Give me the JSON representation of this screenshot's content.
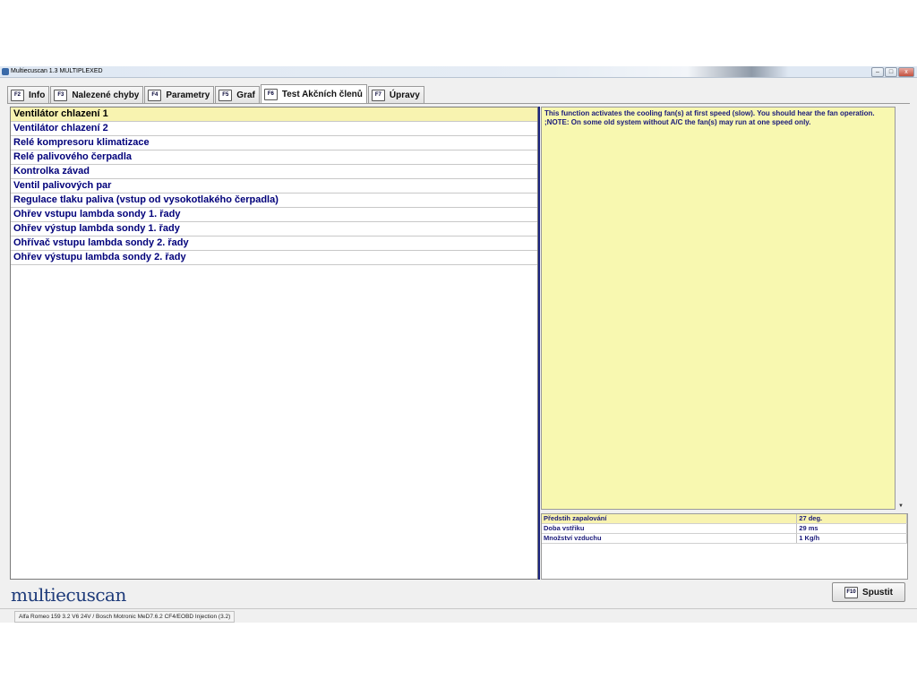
{
  "window": {
    "title": "Multiecuscan 1.3 MULTIPLEXED",
    "minimize": "–",
    "maximize": "□",
    "close": "x"
  },
  "tabs": [
    {
      "key": "F2",
      "label": "Info"
    },
    {
      "key": "F3",
      "label": "Nalezené chyby"
    },
    {
      "key": "F4",
      "label": "Parametry"
    },
    {
      "key": "F5",
      "label": "Graf"
    },
    {
      "key": "F6",
      "label": "Test Akčních členů"
    },
    {
      "key": "F7",
      "label": "Úpravy"
    }
  ],
  "active_tab": "F6",
  "actuators": [
    "Ventilátor chlazení 1",
    "Ventilátor chlazení 2",
    "Relé kompresoru klimatizace",
    "Relé palivového čerpadla",
    "Kontrolka závad",
    "Ventil palivových par",
    "Regulace tlaku paliva (vstup od vysokotlakého čerpadla)",
    "Ohřev vstupu lambda sondy 1. řady",
    "Ohřev výstup lambda sondy 1. řady",
    "Ohřívač vstupu lambda sondy 2. řady",
    "Ohřev výstupu lambda sondy 2. řady"
  ],
  "selected_actuator": 0,
  "description": {
    "line1": "This function activates the cooling fan(s) at first speed (slow). You should hear the fan operation.",
    "line2": ";NOTE: On some old system without A/C the fan(s) may run at one speed only."
  },
  "parameters": [
    {
      "name": "Předstih zapalování",
      "value": "27 deg."
    },
    {
      "name": "Doba vstřiku",
      "value": "29 ms"
    },
    {
      "name": "Množství vzduchu",
      "value": "1 Kg/h"
    }
  ],
  "logo": "multiecuscan",
  "run_button": {
    "key": "F10",
    "label": "Spustit"
  },
  "status": "Alfa Romeo 159 3.2 V6 24V / Bosch Motronic MeD7.6.2 CF4/EOBD Injection (3.2)",
  "colors": {
    "selected_row": "#f8f3b0",
    "description_bg": "#f8f8b0",
    "text_blue": "#00007a",
    "divider": "#1a237e"
  }
}
